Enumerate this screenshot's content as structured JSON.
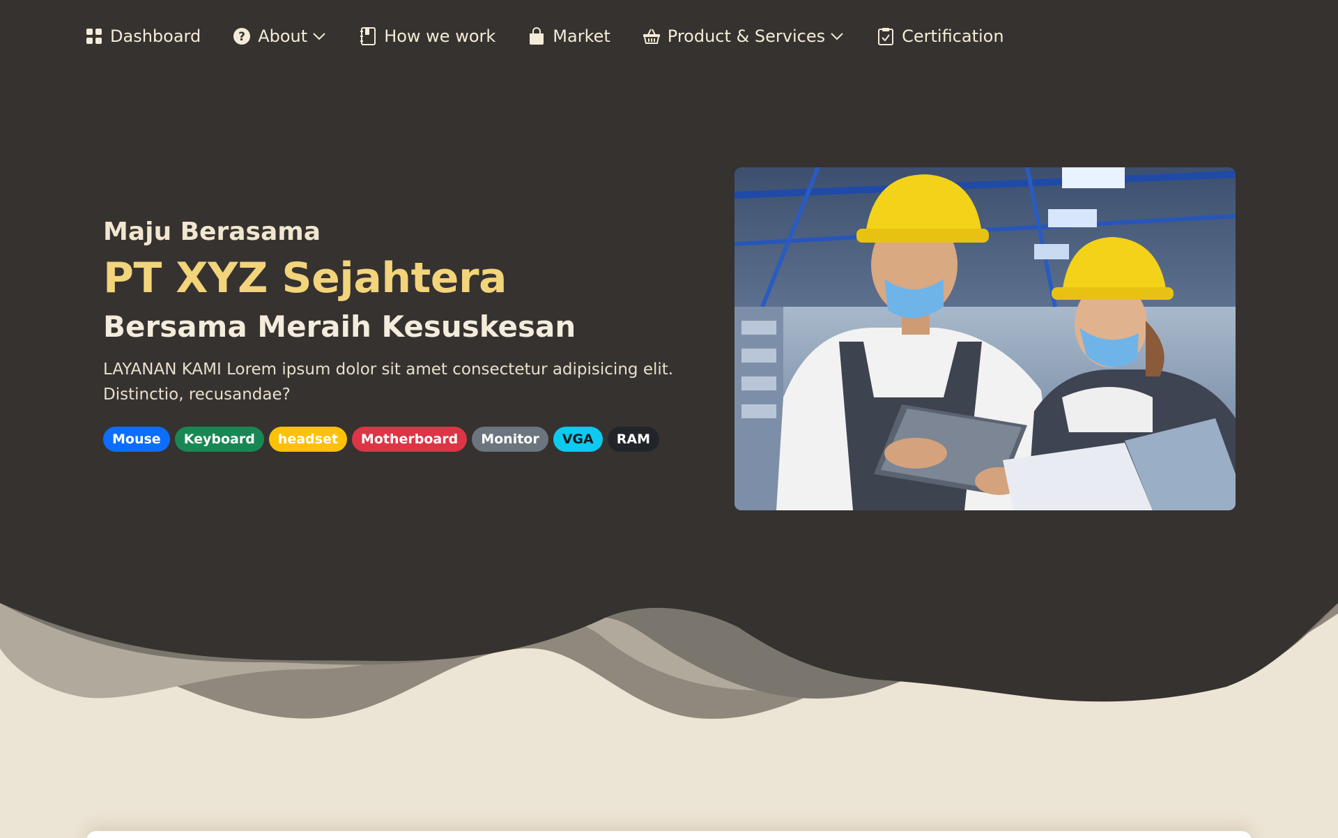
{
  "nav": {
    "items": [
      {
        "label": "Dashboard",
        "icon": "grid-icon",
        "dropdown": false
      },
      {
        "label": "About",
        "icon": "question-circle-icon",
        "dropdown": true
      },
      {
        "label": "How we work",
        "icon": "journal-icon",
        "dropdown": false
      },
      {
        "label": "Market",
        "icon": "shopping-bag-icon",
        "dropdown": false
      },
      {
        "label": "Product & Services",
        "icon": "basket-icon",
        "dropdown": true
      },
      {
        "label": "Certification",
        "icon": "clipboard-check-icon",
        "dropdown": false
      }
    ]
  },
  "hero": {
    "tagline": "Maju Berasama",
    "company": "PT XYZ Sejahtera",
    "slogan": "Bersama Meraih Kesuskesan",
    "description": "LAYANAN KAMI Lorem ipsum dolor sit amet consectetur adipisicing elit. Distinctio, recusandae?",
    "badges": [
      {
        "label": "Mouse",
        "color": "#0d6efd",
        "text_color": "#ffffff"
      },
      {
        "label": "Keyboard",
        "color": "#198754",
        "text_color": "#ffffff"
      },
      {
        "label": "headset",
        "color": "#ffc107",
        "text_color": "#ffffff"
      },
      {
        "label": "Motherboard",
        "color": "#dc3545",
        "text_color": "#ffffff"
      },
      {
        "label": "Monitor",
        "color": "#6c757d",
        "text_color": "#ffffff"
      },
      {
        "label": "VGA",
        "color": "#0dcaf0",
        "text_color": "#1a1a1a"
      },
      {
        "label": "RAM",
        "color": "#212529",
        "text_color": "#ffffff"
      }
    ],
    "image_alt": "two factory workers in yellow hard hats and masks looking at a tablet"
  },
  "colors": {
    "hero_bg": "#363230",
    "page_bg": "#ece4d4",
    "accent": "#f2d47a"
  }
}
